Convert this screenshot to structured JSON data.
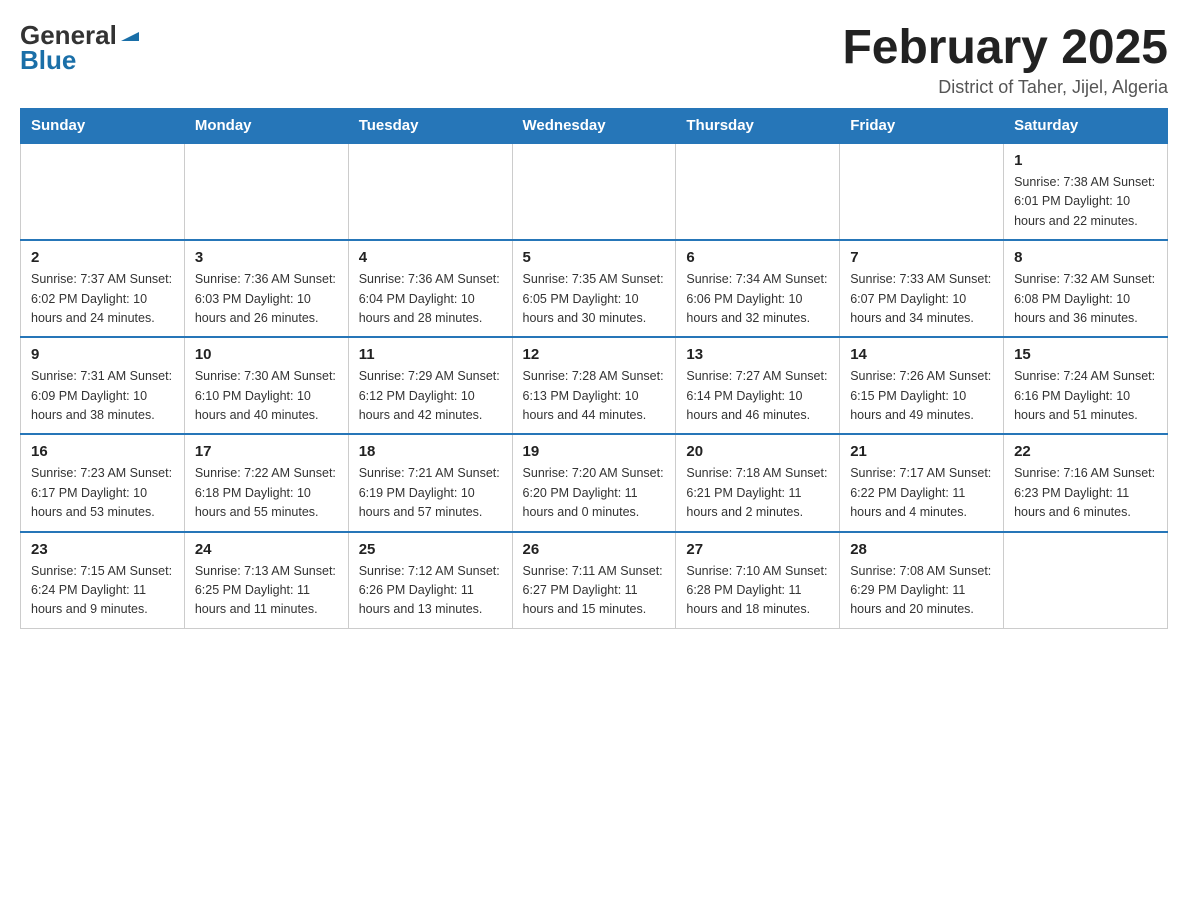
{
  "header": {
    "logo_general": "General",
    "logo_blue": "Blue",
    "title": "February 2025",
    "location": "District of Taher, Jijel, Algeria"
  },
  "days_of_week": [
    "Sunday",
    "Monday",
    "Tuesday",
    "Wednesday",
    "Thursday",
    "Friday",
    "Saturday"
  ],
  "weeks": [
    [
      {
        "day": "",
        "info": ""
      },
      {
        "day": "",
        "info": ""
      },
      {
        "day": "",
        "info": ""
      },
      {
        "day": "",
        "info": ""
      },
      {
        "day": "",
        "info": ""
      },
      {
        "day": "",
        "info": ""
      },
      {
        "day": "1",
        "info": "Sunrise: 7:38 AM\nSunset: 6:01 PM\nDaylight: 10 hours and 22 minutes."
      }
    ],
    [
      {
        "day": "2",
        "info": "Sunrise: 7:37 AM\nSunset: 6:02 PM\nDaylight: 10 hours and 24 minutes."
      },
      {
        "day": "3",
        "info": "Sunrise: 7:36 AM\nSunset: 6:03 PM\nDaylight: 10 hours and 26 minutes."
      },
      {
        "day": "4",
        "info": "Sunrise: 7:36 AM\nSunset: 6:04 PM\nDaylight: 10 hours and 28 minutes."
      },
      {
        "day": "5",
        "info": "Sunrise: 7:35 AM\nSunset: 6:05 PM\nDaylight: 10 hours and 30 minutes."
      },
      {
        "day": "6",
        "info": "Sunrise: 7:34 AM\nSunset: 6:06 PM\nDaylight: 10 hours and 32 minutes."
      },
      {
        "day": "7",
        "info": "Sunrise: 7:33 AM\nSunset: 6:07 PM\nDaylight: 10 hours and 34 minutes."
      },
      {
        "day": "8",
        "info": "Sunrise: 7:32 AM\nSunset: 6:08 PM\nDaylight: 10 hours and 36 minutes."
      }
    ],
    [
      {
        "day": "9",
        "info": "Sunrise: 7:31 AM\nSunset: 6:09 PM\nDaylight: 10 hours and 38 minutes."
      },
      {
        "day": "10",
        "info": "Sunrise: 7:30 AM\nSunset: 6:10 PM\nDaylight: 10 hours and 40 minutes."
      },
      {
        "day": "11",
        "info": "Sunrise: 7:29 AM\nSunset: 6:12 PM\nDaylight: 10 hours and 42 minutes."
      },
      {
        "day": "12",
        "info": "Sunrise: 7:28 AM\nSunset: 6:13 PM\nDaylight: 10 hours and 44 minutes."
      },
      {
        "day": "13",
        "info": "Sunrise: 7:27 AM\nSunset: 6:14 PM\nDaylight: 10 hours and 46 minutes."
      },
      {
        "day": "14",
        "info": "Sunrise: 7:26 AM\nSunset: 6:15 PM\nDaylight: 10 hours and 49 minutes."
      },
      {
        "day": "15",
        "info": "Sunrise: 7:24 AM\nSunset: 6:16 PM\nDaylight: 10 hours and 51 minutes."
      }
    ],
    [
      {
        "day": "16",
        "info": "Sunrise: 7:23 AM\nSunset: 6:17 PM\nDaylight: 10 hours and 53 minutes."
      },
      {
        "day": "17",
        "info": "Sunrise: 7:22 AM\nSunset: 6:18 PM\nDaylight: 10 hours and 55 minutes."
      },
      {
        "day": "18",
        "info": "Sunrise: 7:21 AM\nSunset: 6:19 PM\nDaylight: 10 hours and 57 minutes."
      },
      {
        "day": "19",
        "info": "Sunrise: 7:20 AM\nSunset: 6:20 PM\nDaylight: 11 hours and 0 minutes."
      },
      {
        "day": "20",
        "info": "Sunrise: 7:18 AM\nSunset: 6:21 PM\nDaylight: 11 hours and 2 minutes."
      },
      {
        "day": "21",
        "info": "Sunrise: 7:17 AM\nSunset: 6:22 PM\nDaylight: 11 hours and 4 minutes."
      },
      {
        "day": "22",
        "info": "Sunrise: 7:16 AM\nSunset: 6:23 PM\nDaylight: 11 hours and 6 minutes."
      }
    ],
    [
      {
        "day": "23",
        "info": "Sunrise: 7:15 AM\nSunset: 6:24 PM\nDaylight: 11 hours and 9 minutes."
      },
      {
        "day": "24",
        "info": "Sunrise: 7:13 AM\nSunset: 6:25 PM\nDaylight: 11 hours and 11 minutes."
      },
      {
        "day": "25",
        "info": "Sunrise: 7:12 AM\nSunset: 6:26 PM\nDaylight: 11 hours and 13 minutes."
      },
      {
        "day": "26",
        "info": "Sunrise: 7:11 AM\nSunset: 6:27 PM\nDaylight: 11 hours and 15 minutes."
      },
      {
        "day": "27",
        "info": "Sunrise: 7:10 AM\nSunset: 6:28 PM\nDaylight: 11 hours and 18 minutes."
      },
      {
        "day": "28",
        "info": "Sunrise: 7:08 AM\nSunset: 6:29 PM\nDaylight: 11 hours and 20 minutes."
      },
      {
        "day": "",
        "info": ""
      }
    ]
  ]
}
